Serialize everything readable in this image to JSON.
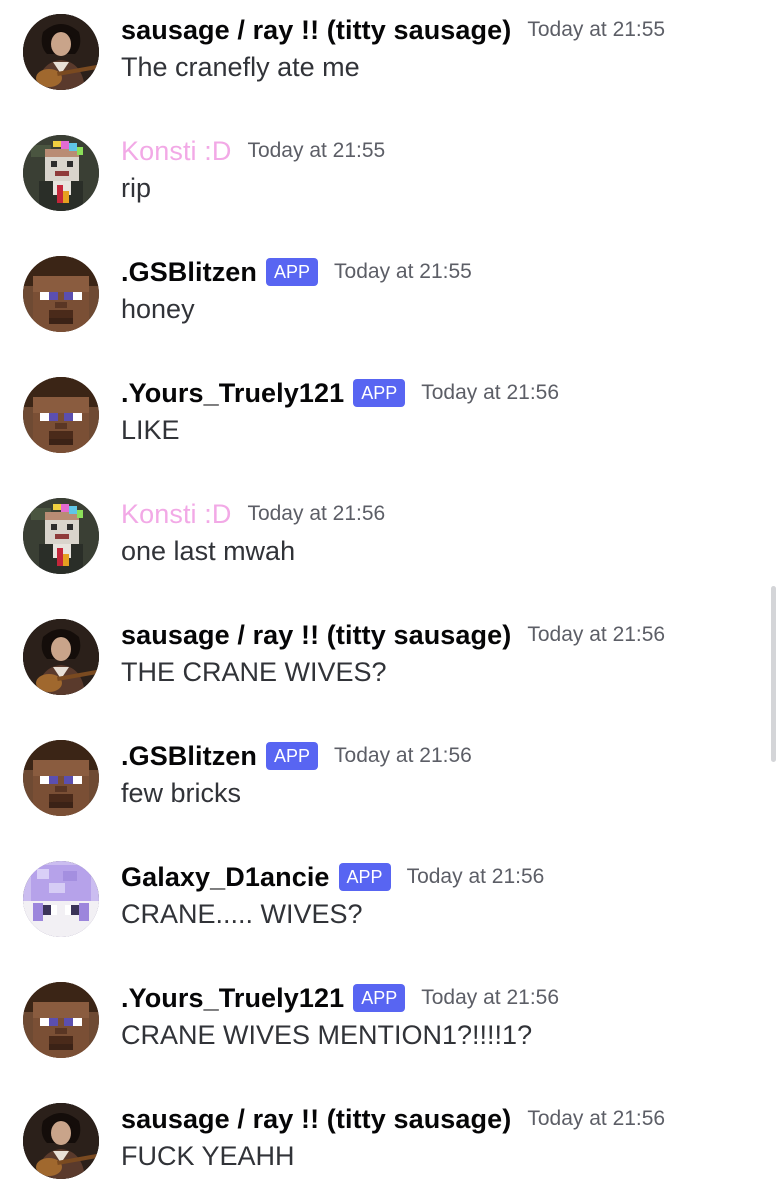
{
  "messages": [
    {
      "author": "sausage / ray !! (titty sausage)",
      "author_color": "#060607",
      "app": "",
      "timestamp": "Today at 21:55",
      "content": "The cranefly ate me",
      "avatar": "person-guitar-avatar"
    },
    {
      "author": "Konsti :D",
      "author_color": "#f2a9e6",
      "app": "",
      "timestamp": "Today at 21:55",
      "content": "rip",
      "avatar": "pixel-character-avatar"
    },
    {
      "author": ".GSBlitzen",
      "author_color": "#060607",
      "app": "APP",
      "timestamp": "Today at 21:55",
      "content": "honey",
      "avatar": "minecraft-steve-avatar"
    },
    {
      "author": ".Yours_Truely121",
      "author_color": "#060607",
      "app": "APP",
      "timestamp": "Today at 21:56",
      "content": "LIKE",
      "avatar": "minecraft-steve-avatar"
    },
    {
      "author": "Konsti :D",
      "author_color": "#f2a9e6",
      "app": "",
      "timestamp": "Today at 21:56",
      "content": "one last mwah",
      "avatar": "pixel-character-avatar"
    },
    {
      "author": "sausage / ray !! (titty sausage)",
      "author_color": "#060607",
      "app": "",
      "timestamp": "Today at 21:56",
      "content": "THE CRANE WIVES?",
      "avatar": "person-guitar-avatar"
    },
    {
      "author": ".GSBlitzen",
      "author_color": "#060607",
      "app": "APP",
      "timestamp": "Today at 21:56",
      "content": "few bricks",
      "avatar": "minecraft-steve-avatar"
    },
    {
      "author": "Galaxy_D1ancie",
      "author_color": "#060607",
      "app": "APP",
      "timestamp": "Today at 21:56",
      "content": "CRANE..... WIVES?",
      "avatar": "purple-pixel-avatar"
    },
    {
      "author": ".Yours_Truely121",
      "author_color": "#060607",
      "app": "APP",
      "timestamp": "Today at 21:56",
      "content": "CRANE WIVES MENTION1?!!!!1?",
      "avatar": "minecraft-steve-avatar"
    },
    {
      "author": "sausage / ray !! (titty sausage)",
      "author_color": "#060607",
      "app": "",
      "timestamp": "Today at 21:56",
      "content": "FUCK YEAHH",
      "avatar": "person-guitar-avatar"
    }
  ],
  "colors": {
    "app_badge": "#5865f2",
    "pink_name": "#f2a9e6",
    "timestamp": "#5c5e66",
    "text": "#313338"
  }
}
